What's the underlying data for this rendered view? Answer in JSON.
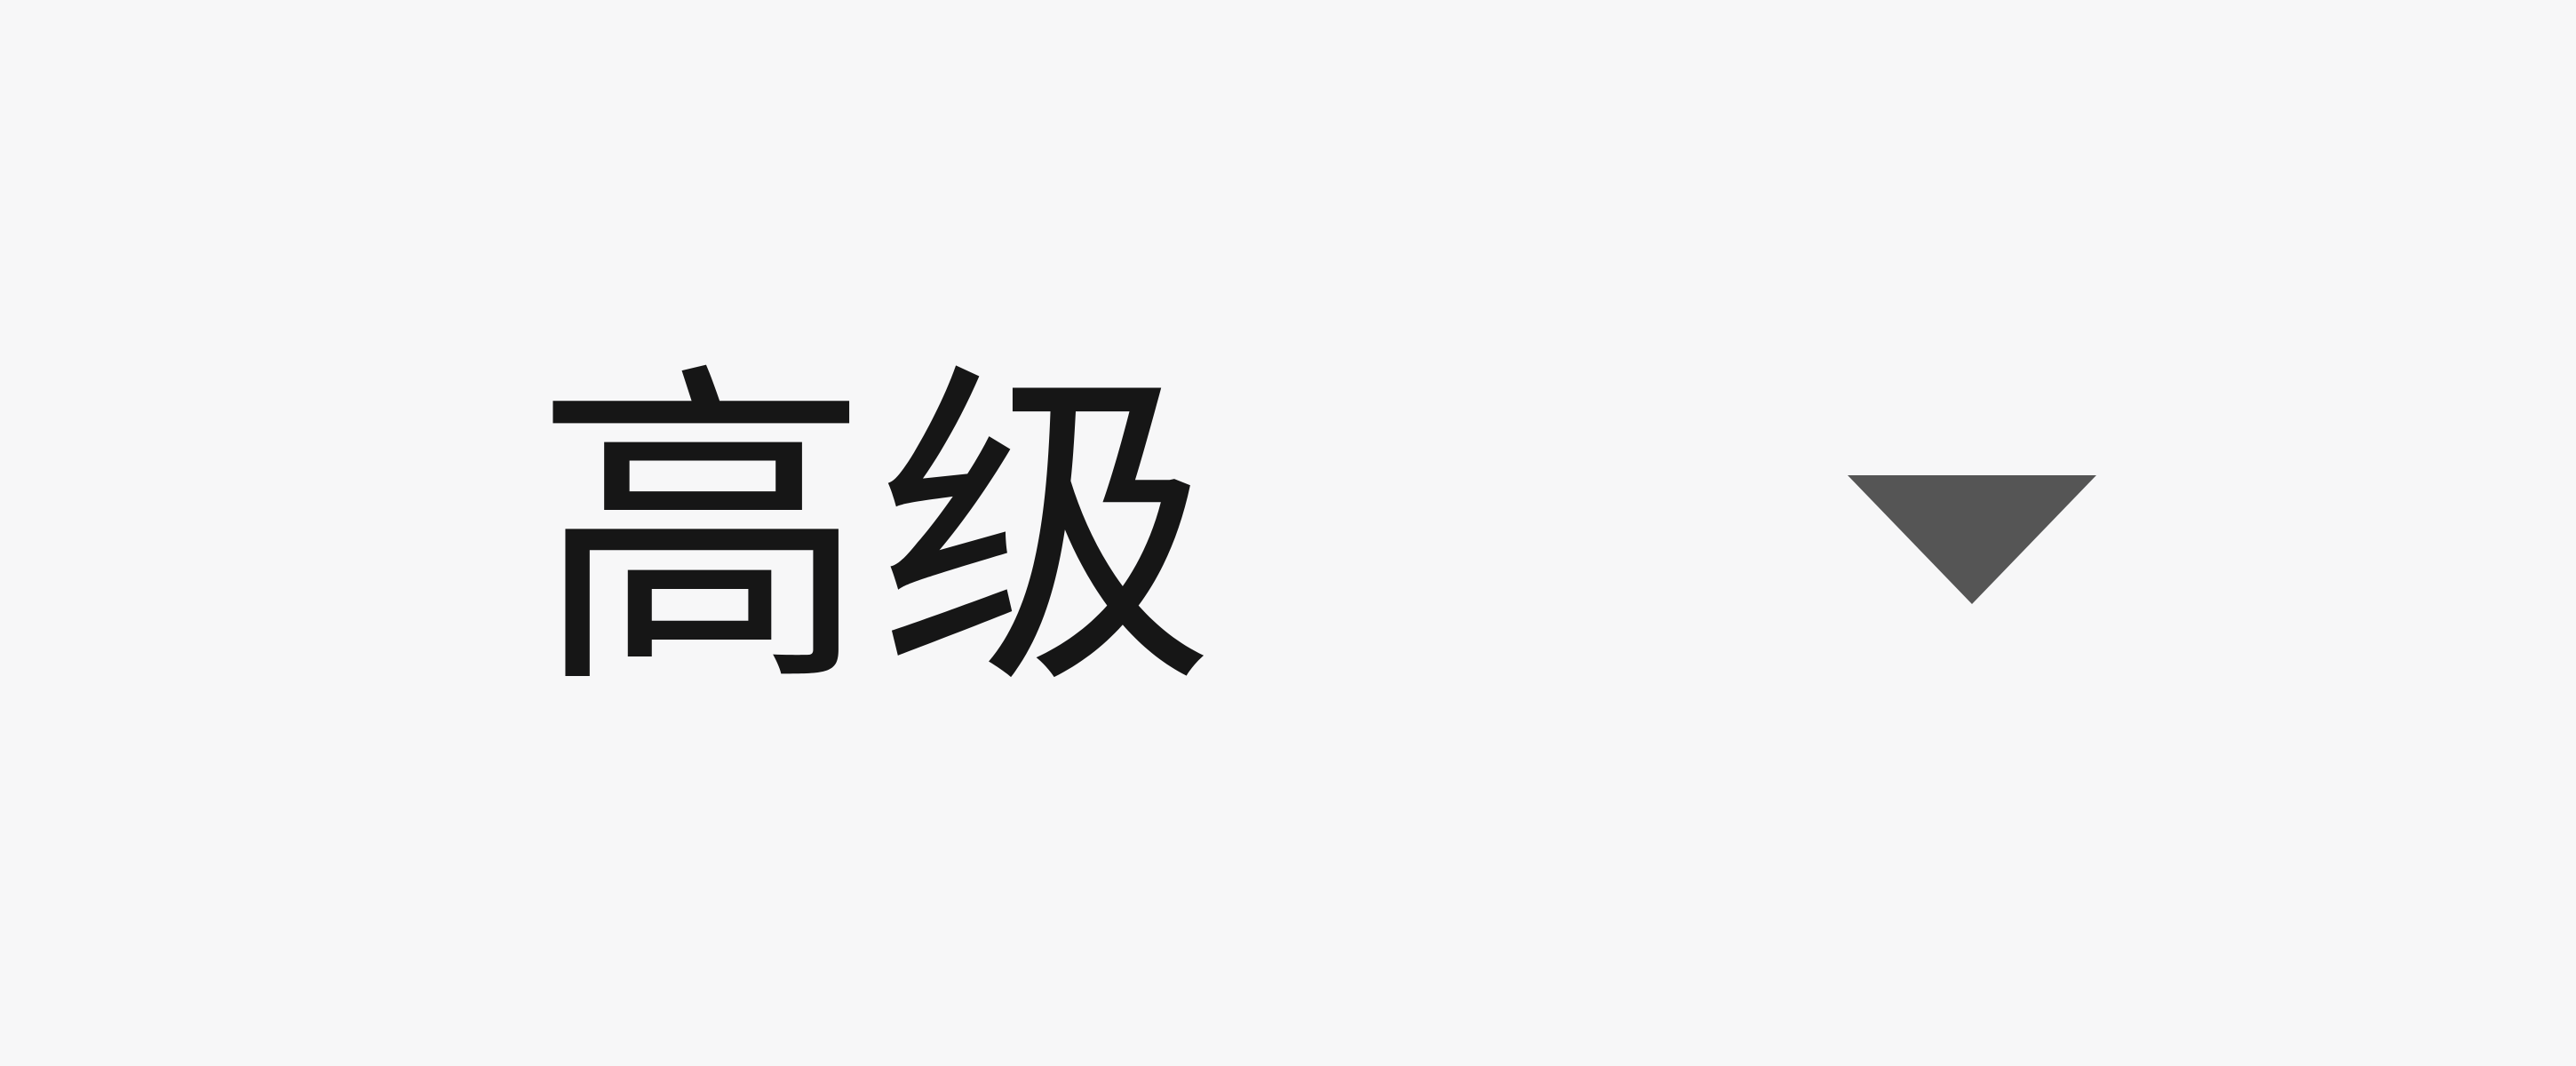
{
  "advanced_dropdown": {
    "label": "高级",
    "icon": "caret-down-icon"
  }
}
